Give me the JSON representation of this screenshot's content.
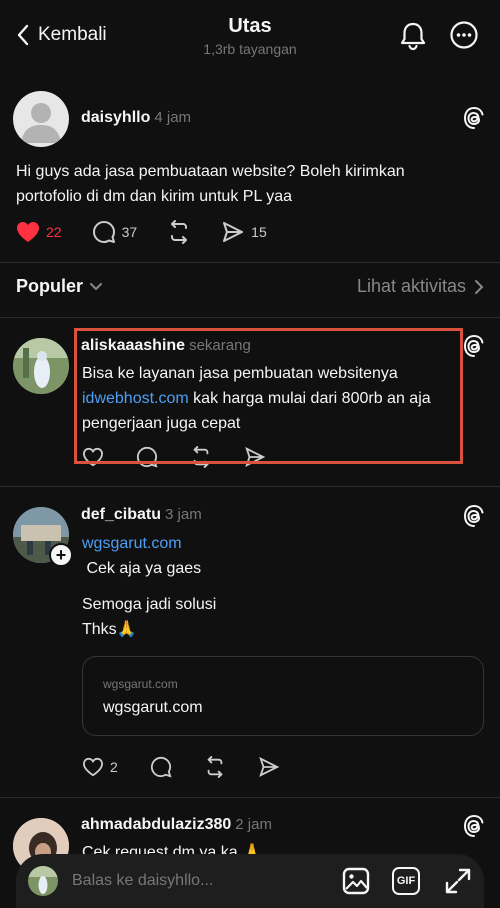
{
  "header": {
    "back_label": "Kembali",
    "title": "Utas",
    "subtitle": "1,3rb tayangan"
  },
  "main_post": {
    "username": "daisyhllo",
    "time": "4 jam",
    "text": "Hi guys ada jasa pembuataan website? Boleh kirimkan portofolio di dm dan kirim untuk PL yaa",
    "likes": "22",
    "comments": "37",
    "shares": "15"
  },
  "sort": {
    "label": "Populer",
    "activity_label": "Lihat aktivitas"
  },
  "replies": [
    {
      "username": "aliskaaashine",
      "time": "sekarang",
      "text_before": "Bisa ke layanan jasa pembuatan websitenya",
      "link": "idwebhost.com",
      "text_after": " kak harga mulai dari 800rb an aja pengerjaan juga cepat"
    },
    {
      "username": "def_cibatu",
      "time": "3 jam",
      "link": "wgsgarut.com",
      "line1": " Cek aja ya gaes",
      "line2": "Semoga jadi solusi",
      "line3": "Thks🙏",
      "card_domain": "wgsgarut.com",
      "card_title": "wgsgarut.com",
      "likes": "2"
    },
    {
      "username": "ahmadabdulaziz380",
      "time": "2 jam",
      "text": "Cek request dm ya ka 🙏"
    }
  ],
  "reply_bar": {
    "placeholder": "Balas ke daisyhllo...",
    "gif_label": "GIF"
  },
  "colors": {
    "background": "#101010",
    "like_red": "#ff3040",
    "link_blue": "#4f9ff4",
    "highlight": "#d9533c"
  }
}
